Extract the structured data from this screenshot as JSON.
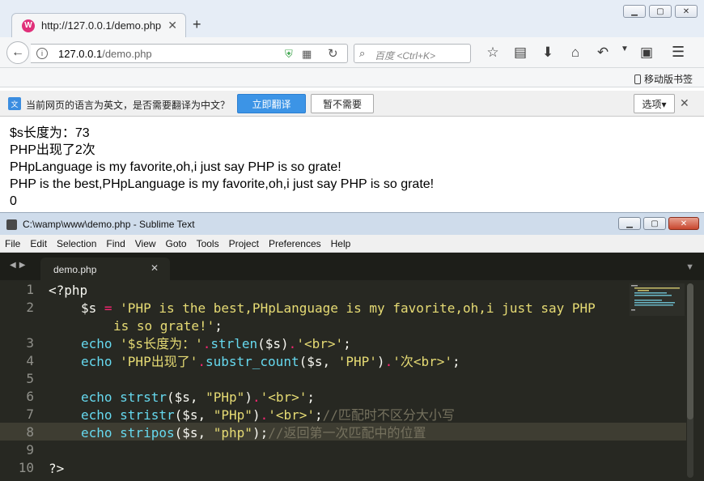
{
  "browser": {
    "tab_title": "http://127.0.0.1/demo.php",
    "tab_icon_glyph": "W",
    "url_host": "127.0.0.1",
    "url_path": "/demo.php",
    "search_placeholder": "百度 <Ctrl+K>",
    "bookmark_mobile": "移动版书签",
    "translate": {
      "icon_glyph": "文",
      "message": "当前网页的语言为英文，是否需要翻译为中文？",
      "translate_button": "立即翻译",
      "no_button": "暂不需要",
      "options_button": "选项▾"
    },
    "page_lines": [
      "$s长度为：73",
      "PHP出现了2次",
      "PHpLanguage is my favorite,oh,i just say PHP is so grate!",
      "PHP is the best,PHpLanguage is my favorite,oh,i just say PHP is so grate!",
      "0"
    ]
  },
  "sublime": {
    "title": "C:\\wamp\\www\\demo.php - Sublime Text",
    "menu": [
      "File",
      "Edit",
      "Selection",
      "Find",
      "View",
      "Goto",
      "Tools",
      "Project",
      "Preferences",
      "Help"
    ],
    "tab_name": "demo.php",
    "line_numbers": [
      "1",
      "2",
      "3",
      "4",
      "5",
      "6",
      "7",
      "8",
      "9",
      "10"
    ],
    "code": {
      "l1": "<?php",
      "l2_var": "$s",
      "l2_op": " = ",
      "l2_str": "'PHP is the best,PHpLanguage is my favorite,oh,i just say PHP",
      "l2b_str": "is so grate!'",
      "l2b_end": ";",
      "l3_kw": "echo",
      "l3_str1": " '$s长度为：'",
      "l3_op1": ".",
      "l3_fn": "strlen",
      "l3_args": "($s)",
      "l3_op2": ".",
      "l3_str2": "'<br>'",
      "l3_end": ";",
      "l4_kw": "echo",
      "l4_str1": " 'PHP出现了'",
      "l4_op1": ".",
      "l4_fn": "substr_count",
      "l4_args": "($s, ",
      "l4_str2": "'PHP'",
      "l4_close": ")",
      "l4_op2": ".",
      "l4_str3": "'次<br>'",
      "l4_end": ";",
      "l6_kw": "echo",
      "l6_fn": " strstr",
      "l6_args": "($s, ",
      "l6_str": "\"PHp\"",
      "l6_close": ")",
      "l6_op": ".",
      "l6_str2": "'<br>'",
      "l6_end": ";",
      "l7_kw": "echo",
      "l7_fn": " stristr",
      "l7_args": "($s, ",
      "l7_str": "\"PHp\"",
      "l7_close": ")",
      "l7_op": ".",
      "l7_str2": "'<br>'",
      "l7_end": ";",
      "l7_cmt": "//匹配时不区分大小写",
      "l8_kw": "echo",
      "l8_fn": " stripos",
      "l8_args": "($s, ",
      "l8_str": "\"php\"",
      "l8_end": ");",
      "l8_cmt": "//返回第一次匹配中的位置",
      "l10": "?>"
    }
  },
  "colors": {
    "editor_bg": "#272822",
    "keyword": "#66d9ef",
    "string": "#e6db74",
    "operator": "#f92672",
    "comment": "#75715e",
    "translate_button": "#3c94e6"
  }
}
